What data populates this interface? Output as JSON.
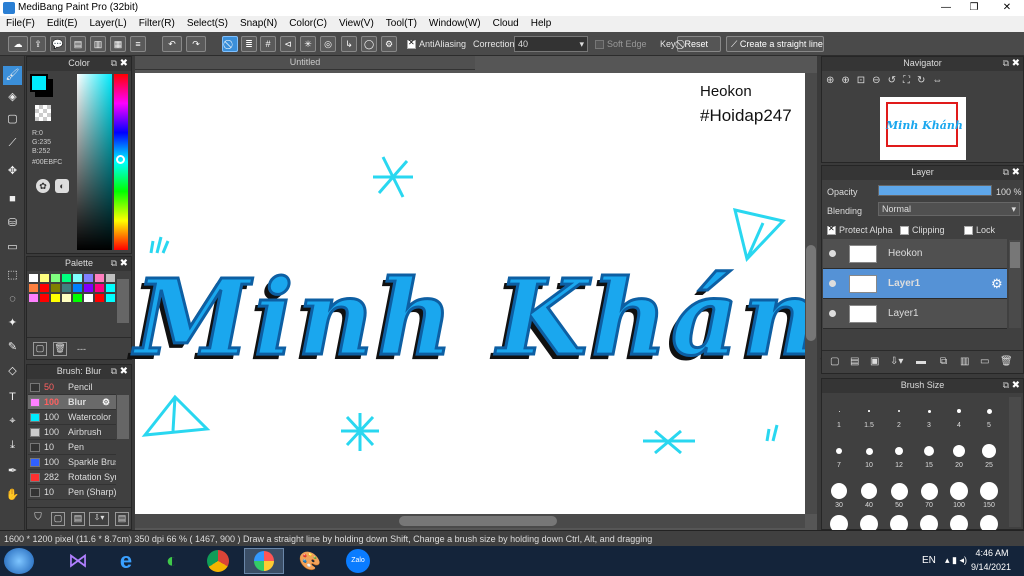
{
  "window": {
    "title": "MediBang Paint Pro (32bit)"
  },
  "menu": [
    "File(F)",
    "Edit(E)",
    "Layer(L)",
    "Filter(R)",
    "Select(S)",
    "Snap(N)",
    "Color(C)",
    "View(V)",
    "Tool(T)",
    "Window(W)",
    "Cloud",
    "Help"
  ],
  "toolbar": {
    "antialiasing_label": "AntiAliasing",
    "correction_label": "Correction",
    "correction_value": "40",
    "soft_edge_label": "Soft Edge",
    "key_label": "Key",
    "reset_label": "Reset",
    "straight_line_label": "Create a straight line"
  },
  "color_panel": {
    "title": "Color",
    "r": "R:0",
    "g": "G:235",
    "b": "B:252",
    "hex": "#00EBFC",
    "foreground": "#00EBFC"
  },
  "palette_panel": {
    "title": "Palette",
    "colors": [
      "#ffffff",
      "#ffff80",
      "#80ff80",
      "#00ff80",
      "#80ffff",
      "#8080ff",
      "#ff80c0",
      "#c0c0c0",
      "#ff8040",
      "#ff0000",
      "#808000",
      "#408080",
      "#0080ff",
      "#8000ff",
      "#ff0080",
      "#00ffff",
      "#ff80ff",
      "#ff0000",
      "#ffff00",
      "#ffffc0",
      "#00ff00",
      "#ffffff",
      "#ff0000",
      "#00ffff"
    ],
    "footer_text": "---"
  },
  "brush_panel": {
    "title": "Brush: Blur",
    "items": [
      {
        "size": "50",
        "name": "Pencil",
        "color": "#333333",
        "size_color": "#ff6060"
      },
      {
        "size": "100",
        "name": "Blur",
        "color": "#ff80ff",
        "size_color": "#ff6060"
      },
      {
        "size": "100",
        "name": "Watercolor",
        "color": "#00EBFC",
        "size_color": "#dddddd"
      },
      {
        "size": "100",
        "name": "Airbrush",
        "color": "#cccccc",
        "size_color": "#dddddd"
      },
      {
        "size": "10",
        "name": "Pen",
        "color": "#333333",
        "size_color": "#dddddd"
      },
      {
        "size": "100",
        "name": "Sparkle Brush",
        "color": "#3060ff",
        "size_color": "#dddddd"
      },
      {
        "size": "282",
        "name": "Rotation Sym",
        "color": "#ff3030",
        "size_color": "#dddddd"
      },
      {
        "size": "10",
        "name": "Pen (Sharp)",
        "color": "#333333",
        "size_color": "#dddddd"
      }
    ]
  },
  "canvas": {
    "tab_title": "Untitled",
    "watermark_line1": "Heokon",
    "watermark_line2": "#Hoidap247",
    "artwork_text": "Minh Khánh",
    "accent": "#00EBFC"
  },
  "navigator": {
    "title": "Navigator"
  },
  "layer_panel": {
    "title": "Layer",
    "opacity_label": "Opacity",
    "opacity_value": "100 %",
    "opacity_fraction": 1.0,
    "blending_label": "Blending",
    "blending_value": "Normal",
    "protect_alpha_label": "Protect Alpha",
    "clipping_label": "Clipping",
    "lock_label": "Lock",
    "layers": [
      {
        "name": "Heokon",
        "selected": false
      },
      {
        "name": "Layer1",
        "selected": true
      },
      {
        "name": "Layer1",
        "selected": false
      }
    ]
  },
  "brush_size_panel": {
    "title": "Brush Size",
    "sizes": [
      "1",
      "1.5",
      "2",
      "3",
      "4",
      "5",
      "7",
      "10",
      "12",
      "15",
      "20",
      "25",
      "30",
      "40",
      "50",
      "70",
      "100",
      "150"
    ]
  },
  "status": {
    "text": "1600 * 1200 pixel  (11.6 * 8.7cm)  350 dpi  66 %  ( 1467, 900 )  Draw a straight line by holding down Shift, Change a brush size by holding down Ctrl, Alt, and dragging"
  },
  "taskbar": {
    "lang": "EN",
    "time": "4:46 AM",
    "date": "9/14/2021"
  }
}
